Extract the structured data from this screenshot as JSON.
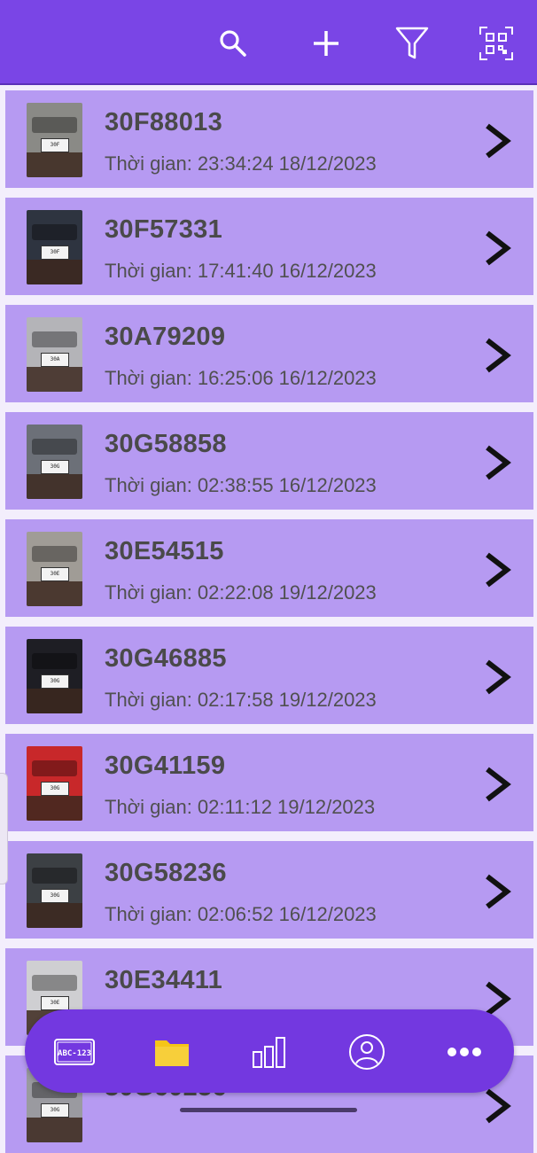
{
  "toolbar": {
    "search_icon": "search-icon",
    "add_icon": "plus-icon",
    "filter_icon": "filter-icon",
    "qr_icon": "qr-scan-icon"
  },
  "label_prefix": "Thời gian: ",
  "records": [
    {
      "plate": "30F88013",
      "time": "Thời gian: 23:34:24 18/12/2023",
      "car_color": "#8a8a86",
      "plate_label": "30F"
    },
    {
      "plate": "30F57331",
      "time": "Thời gian: 17:41:40 16/12/2023",
      "car_color": "#2e3440",
      "plate_label": "30F"
    },
    {
      "plate": "30A79209",
      "time": "Thời gian: 16:25:06 16/12/2023",
      "car_color": "#b4b4b8",
      "plate_label": "30A"
    },
    {
      "plate": "30G58858",
      "time": "Thời gian: 02:38:55 16/12/2023",
      "car_color": "#6c7078",
      "plate_label": "30G"
    },
    {
      "plate": "30E54515",
      "time": "Thời gian: 02:22:08 19/12/2023",
      "car_color": "#a09c96",
      "plate_label": "30E"
    },
    {
      "plate": "30G46885",
      "time": "Thời gian: 02:17:58 19/12/2023",
      "car_color": "#1e1e24",
      "plate_label": "30G"
    },
    {
      "plate": "30G41159",
      "time": "Thời gian: 02:11:12 19/12/2023",
      "car_color": "#c8282a",
      "plate_label": "30G"
    },
    {
      "plate": "30G58236",
      "time": "Thời gian: 02:06:52 16/12/2023",
      "car_color": "#3c4044",
      "plate_label": "30G"
    },
    {
      "plate": "30E34411",
      "time": "",
      "car_color": "#cfcfd2",
      "plate_label": "30E"
    },
    {
      "plate": "30G60256",
      "time": "",
      "car_color": "#9a9aa0",
      "plate_label": "30G"
    }
  ],
  "bottom_nav": [
    {
      "name": "nav-plates",
      "icon": "license-plate-icon",
      "label": "ABC-123",
      "active": false
    },
    {
      "name": "nav-folder",
      "icon": "folder-icon",
      "active": true
    },
    {
      "name": "nav-stats",
      "icon": "bar-chart-icon",
      "active": false
    },
    {
      "name": "nav-profile",
      "icon": "user-icon",
      "active": false
    },
    {
      "name": "nav-more",
      "icon": "more-dots-icon",
      "active": false
    }
  ],
  "colors": {
    "accent": "#7a45e6",
    "row_bg": "#b69af2",
    "nav_bg": "#7338e0",
    "active_icon": "#f5c518"
  }
}
